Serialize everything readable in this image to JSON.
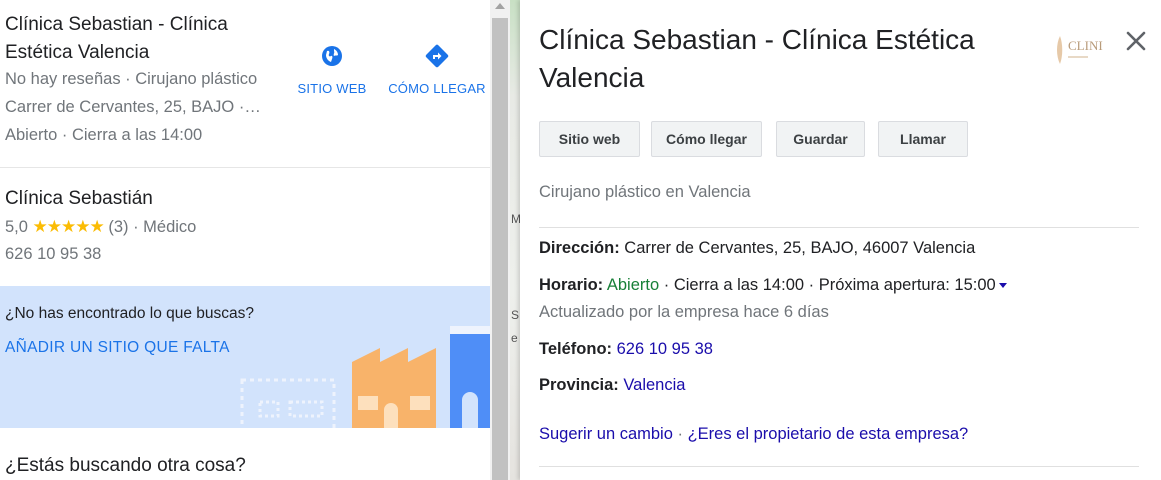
{
  "results": {
    "first": {
      "title": "Clínica Sebastian - Clínica Estética Valencia",
      "meta": "No hay reseñas · Cirujano plástico",
      "address": "Carrer de Cervantes, 25, BAJO ·…",
      "hours": "Abierto · Cierra a las 14:00",
      "website_label": "SITIO WEB",
      "directions_label": "CÓMO LLEGAR"
    },
    "second": {
      "title": "Clínica Sebastián",
      "rating": "5,0",
      "stars": "★★★★★",
      "reviews": "(3)",
      "category": "· Médico",
      "phone": "626 10 95 38"
    }
  },
  "missing": {
    "question": "¿No has encontrado lo que buscas?",
    "link": "AÑADIR UN SITIO QUE FALTA"
  },
  "other_search": "¿Estás buscando otra cosa?",
  "map_labels": [
    "Mo",
    "S",
    "e"
  ],
  "detail": {
    "title": "Clínica Sebastian - Clínica Estética Valencia",
    "logo_text": "CLINI",
    "buttons": {
      "website": "Sitio web",
      "directions": "Cómo llegar",
      "save": "Guardar",
      "call": "Llamar"
    },
    "category": "Cirujano plástico en Valencia",
    "address_label": "Dirección:",
    "address": "Carrer de Cervantes, 25, BAJO, 46007 Valencia",
    "hours_label": "Horario:",
    "hours_status": "Abierto",
    "hours_rest": "· Cierra a las 14:00 · Próxima apertura: 15:00",
    "updated": "Actualizado por la empresa hace 6 días",
    "phone_label": "Teléfono:",
    "phone": "626 10 95 38",
    "province_label": "Provincia:",
    "province": "Valencia",
    "suggest": "Sugerir un cambio",
    "separator": "·",
    "owner": "¿Eres el propietario de esta empresa?"
  },
  "colors": {
    "link_blue": "#1a73e8",
    "open_green": "#188038",
    "star_yellow": "#fbbc04",
    "missing_bg": "#d2e3fc"
  }
}
